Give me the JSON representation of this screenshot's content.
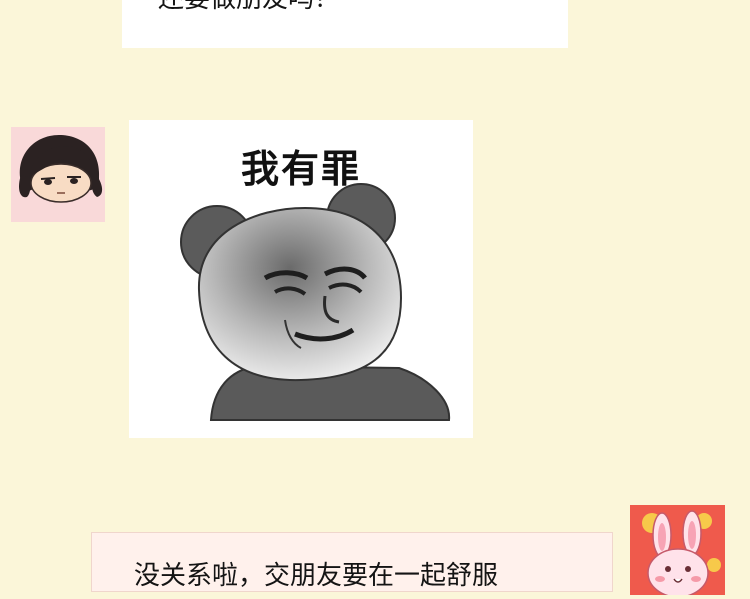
{
  "messages": {
    "top_text": "还要做朋友吗？",
    "bottom_text": "没关系啦，交朋友要在一起舒服",
    "meme_caption": "我有罪"
  },
  "colors": {
    "background": "#fbf6d9",
    "bubble_left": "#ffffff",
    "bubble_right": "#fff1ec",
    "avatar_left_bg": "#f9d9d9",
    "avatar_right_bg": "#ef5a4c"
  },
  "icons": {
    "left_avatar": "girl-face-icon",
    "right_avatar": "pink-rabbit-icon",
    "meme": "panda-head-meme"
  }
}
